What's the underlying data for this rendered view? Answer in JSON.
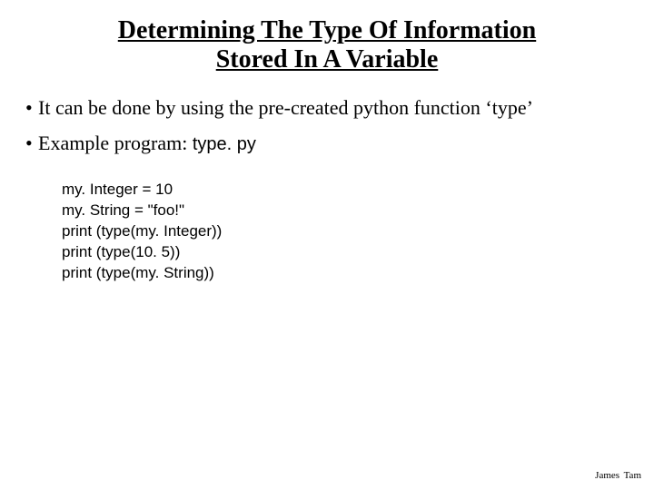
{
  "title": "Determining The Type Of Information Stored In A Variable",
  "bullets": [
    {
      "dot": "•",
      "text": "It can be done by using the pre-created python function ‘type’"
    },
    {
      "dot": "•",
      "text_prefix": "Example program: ",
      "code": "type. py"
    }
  ],
  "code_block": "my. Integer = 10\nmy. String = \"foo!\"\nprint (type(my. Integer))\nprint (type(10. 5))\nprint (type(my. String))",
  "footer": "James Tam"
}
